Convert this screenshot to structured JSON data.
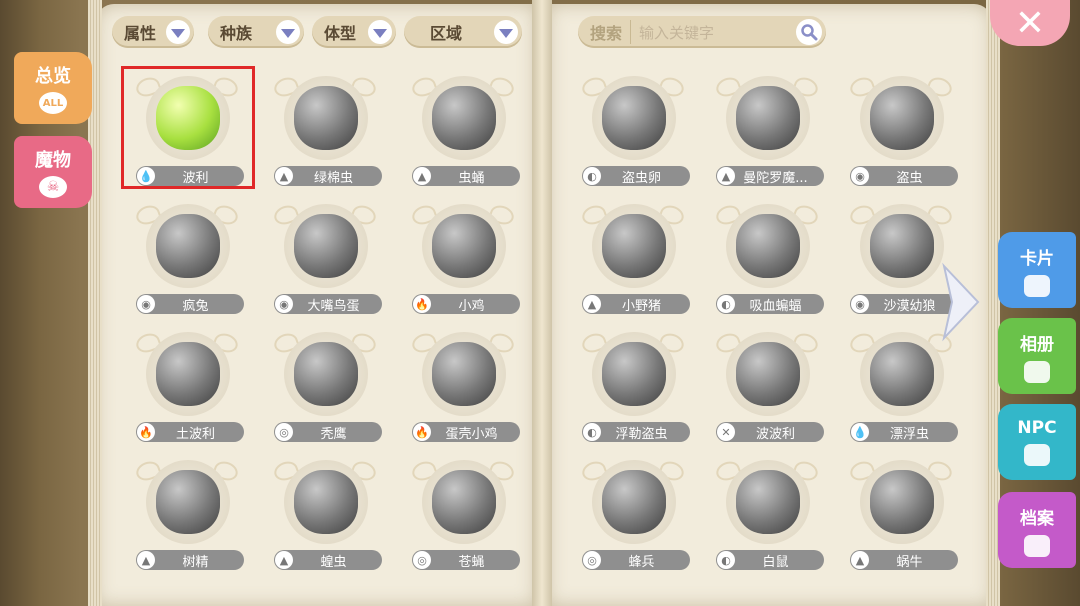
{
  "filters": [
    {
      "label": "属性"
    },
    {
      "label": "种族"
    },
    {
      "label": "体型"
    },
    {
      "label": "区域"
    }
  ],
  "search": {
    "label": "搜索",
    "placeholder": "输入关键字"
  },
  "left_tabs": [
    {
      "label": "总览",
      "sub": "ALL",
      "color": "#f0a95a"
    },
    {
      "label": "魔物",
      "sub": "☠",
      "color": "#e86a86"
    }
  ],
  "right_tabs": [
    {
      "label": "卡片",
      "color": "#4f9be8"
    },
    {
      "label": "相册",
      "color": "#6ac24a"
    },
    {
      "label": "NPC",
      "color": "#33b7c9"
    },
    {
      "label": "档案",
      "color": "#c45ac9"
    }
  ],
  "left_page": [
    {
      "name": "波利",
      "attr": "💧",
      "selected": true
    },
    {
      "name": "绿棉虫",
      "attr": "▲"
    },
    {
      "name": "虫蛹",
      "attr": "▲"
    },
    {
      "name": "疯兔",
      "attr": "◉"
    },
    {
      "name": "大嘴鸟蛋",
      "attr": "◉"
    },
    {
      "name": "小鸡",
      "attr": "🔥"
    },
    {
      "name": "土波利",
      "attr": "🔥"
    },
    {
      "name": "秃鹰",
      "attr": "◎"
    },
    {
      "name": "蛋壳小鸡",
      "attr": "🔥"
    },
    {
      "name": "树精",
      "attr": "▲"
    },
    {
      "name": "蝗虫",
      "attr": "▲"
    },
    {
      "name": "苍蝇",
      "attr": "◎"
    }
  ],
  "right_page": [
    {
      "name": "盗虫卵",
      "attr": "◐"
    },
    {
      "name": "曼陀罗魔...",
      "attr": "▲"
    },
    {
      "name": "盗虫",
      "attr": "◉"
    },
    {
      "name": "小野猪",
      "attr": "▲"
    },
    {
      "name": "吸血蝙蝠",
      "attr": "◐"
    },
    {
      "name": "沙漠幼狼",
      "attr": "◉"
    },
    {
      "name": "浮勒盗虫",
      "attr": "◐"
    },
    {
      "name": "波波利",
      "attr": "✕"
    },
    {
      "name": "漂浮虫",
      "attr": "💧"
    },
    {
      "name": "蜂兵",
      "attr": "◎"
    },
    {
      "name": "白鼠",
      "attr": "◐"
    },
    {
      "name": "蜗牛",
      "attr": "▲"
    }
  ],
  "colors": {
    "selected_border": "#e02828",
    "namebar": "#8f8f8f",
    "page": "#f2ecdc"
  },
  "icons": {
    "close": "close-icon",
    "next": "arrow-right-icon",
    "search": "search-icon"
  }
}
